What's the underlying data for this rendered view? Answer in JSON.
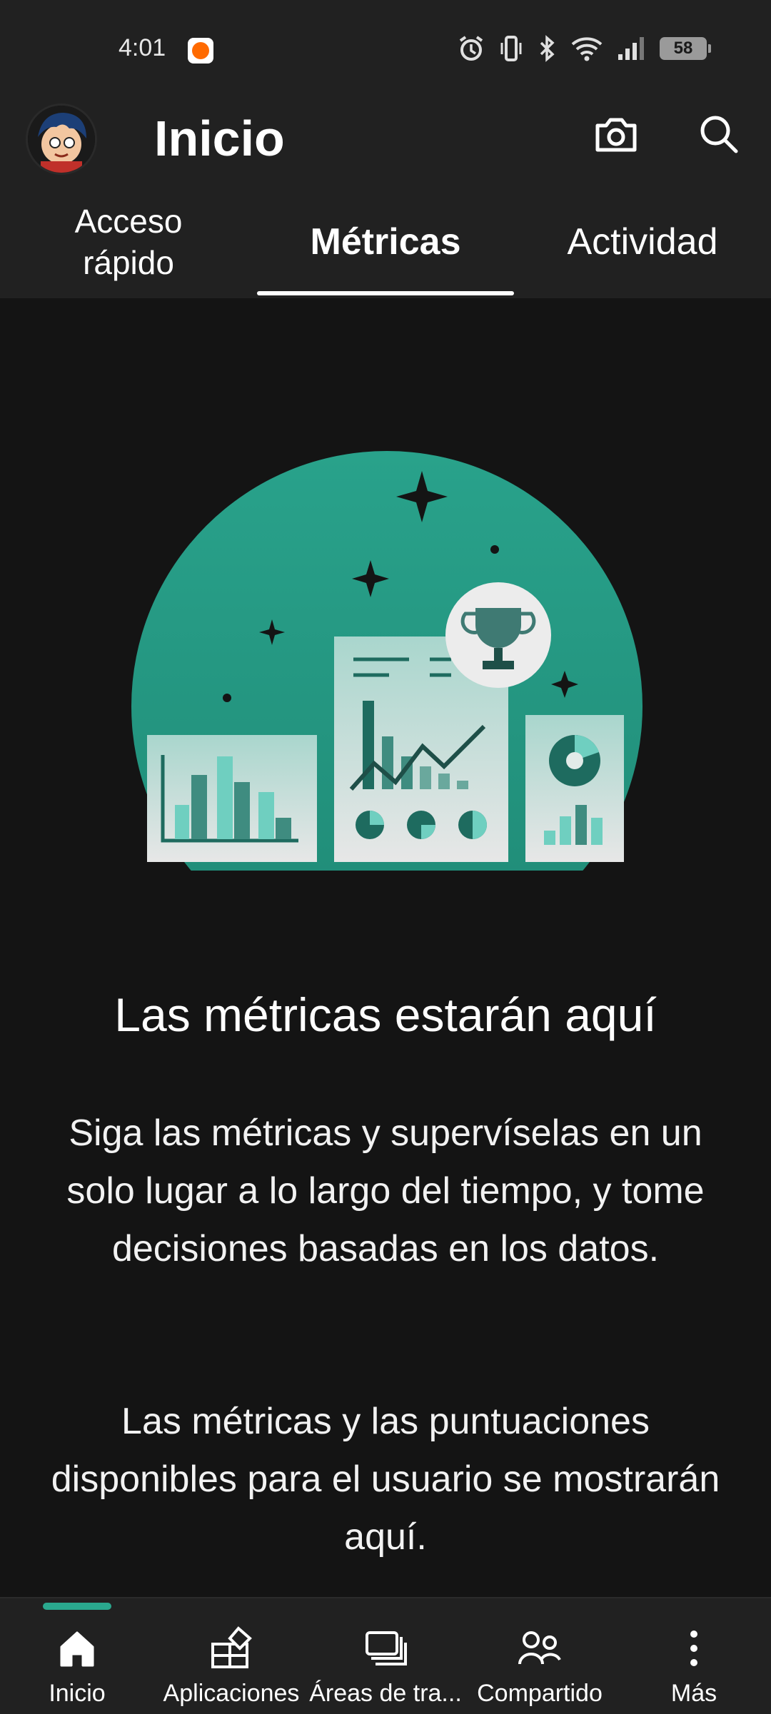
{
  "status_bar": {
    "time": "4:01",
    "battery": "58"
  },
  "header": {
    "title": "Inicio"
  },
  "tabs": [
    {
      "label": "Acceso rápido"
    },
    {
      "label": "Métricas"
    },
    {
      "label": "Actividad"
    }
  ],
  "empty_state": {
    "title": "Las métricas estarán aquí",
    "description": "Siga las métricas y supervíselas en un solo lugar a lo largo del tiempo, y tome decisiones basadas en los datos.",
    "description2": "Las métricas y las puntuaciones disponibles para el usuario se mostrarán aquí."
  },
  "bottom_nav": {
    "items": [
      {
        "label": "Inicio",
        "icon": "home-icon"
      },
      {
        "label": "Aplicaciones",
        "icon": "apps-icon"
      },
      {
        "label": "Áreas de tra...",
        "icon": "workspaces-icon"
      },
      {
        "label": "Compartido",
        "icon": "shared-icon"
      },
      {
        "label": "Más",
        "icon": "more-icon"
      }
    ]
  },
  "colors": {
    "accent": "#2aa88e",
    "background": "#141414",
    "bar": "#212121"
  }
}
